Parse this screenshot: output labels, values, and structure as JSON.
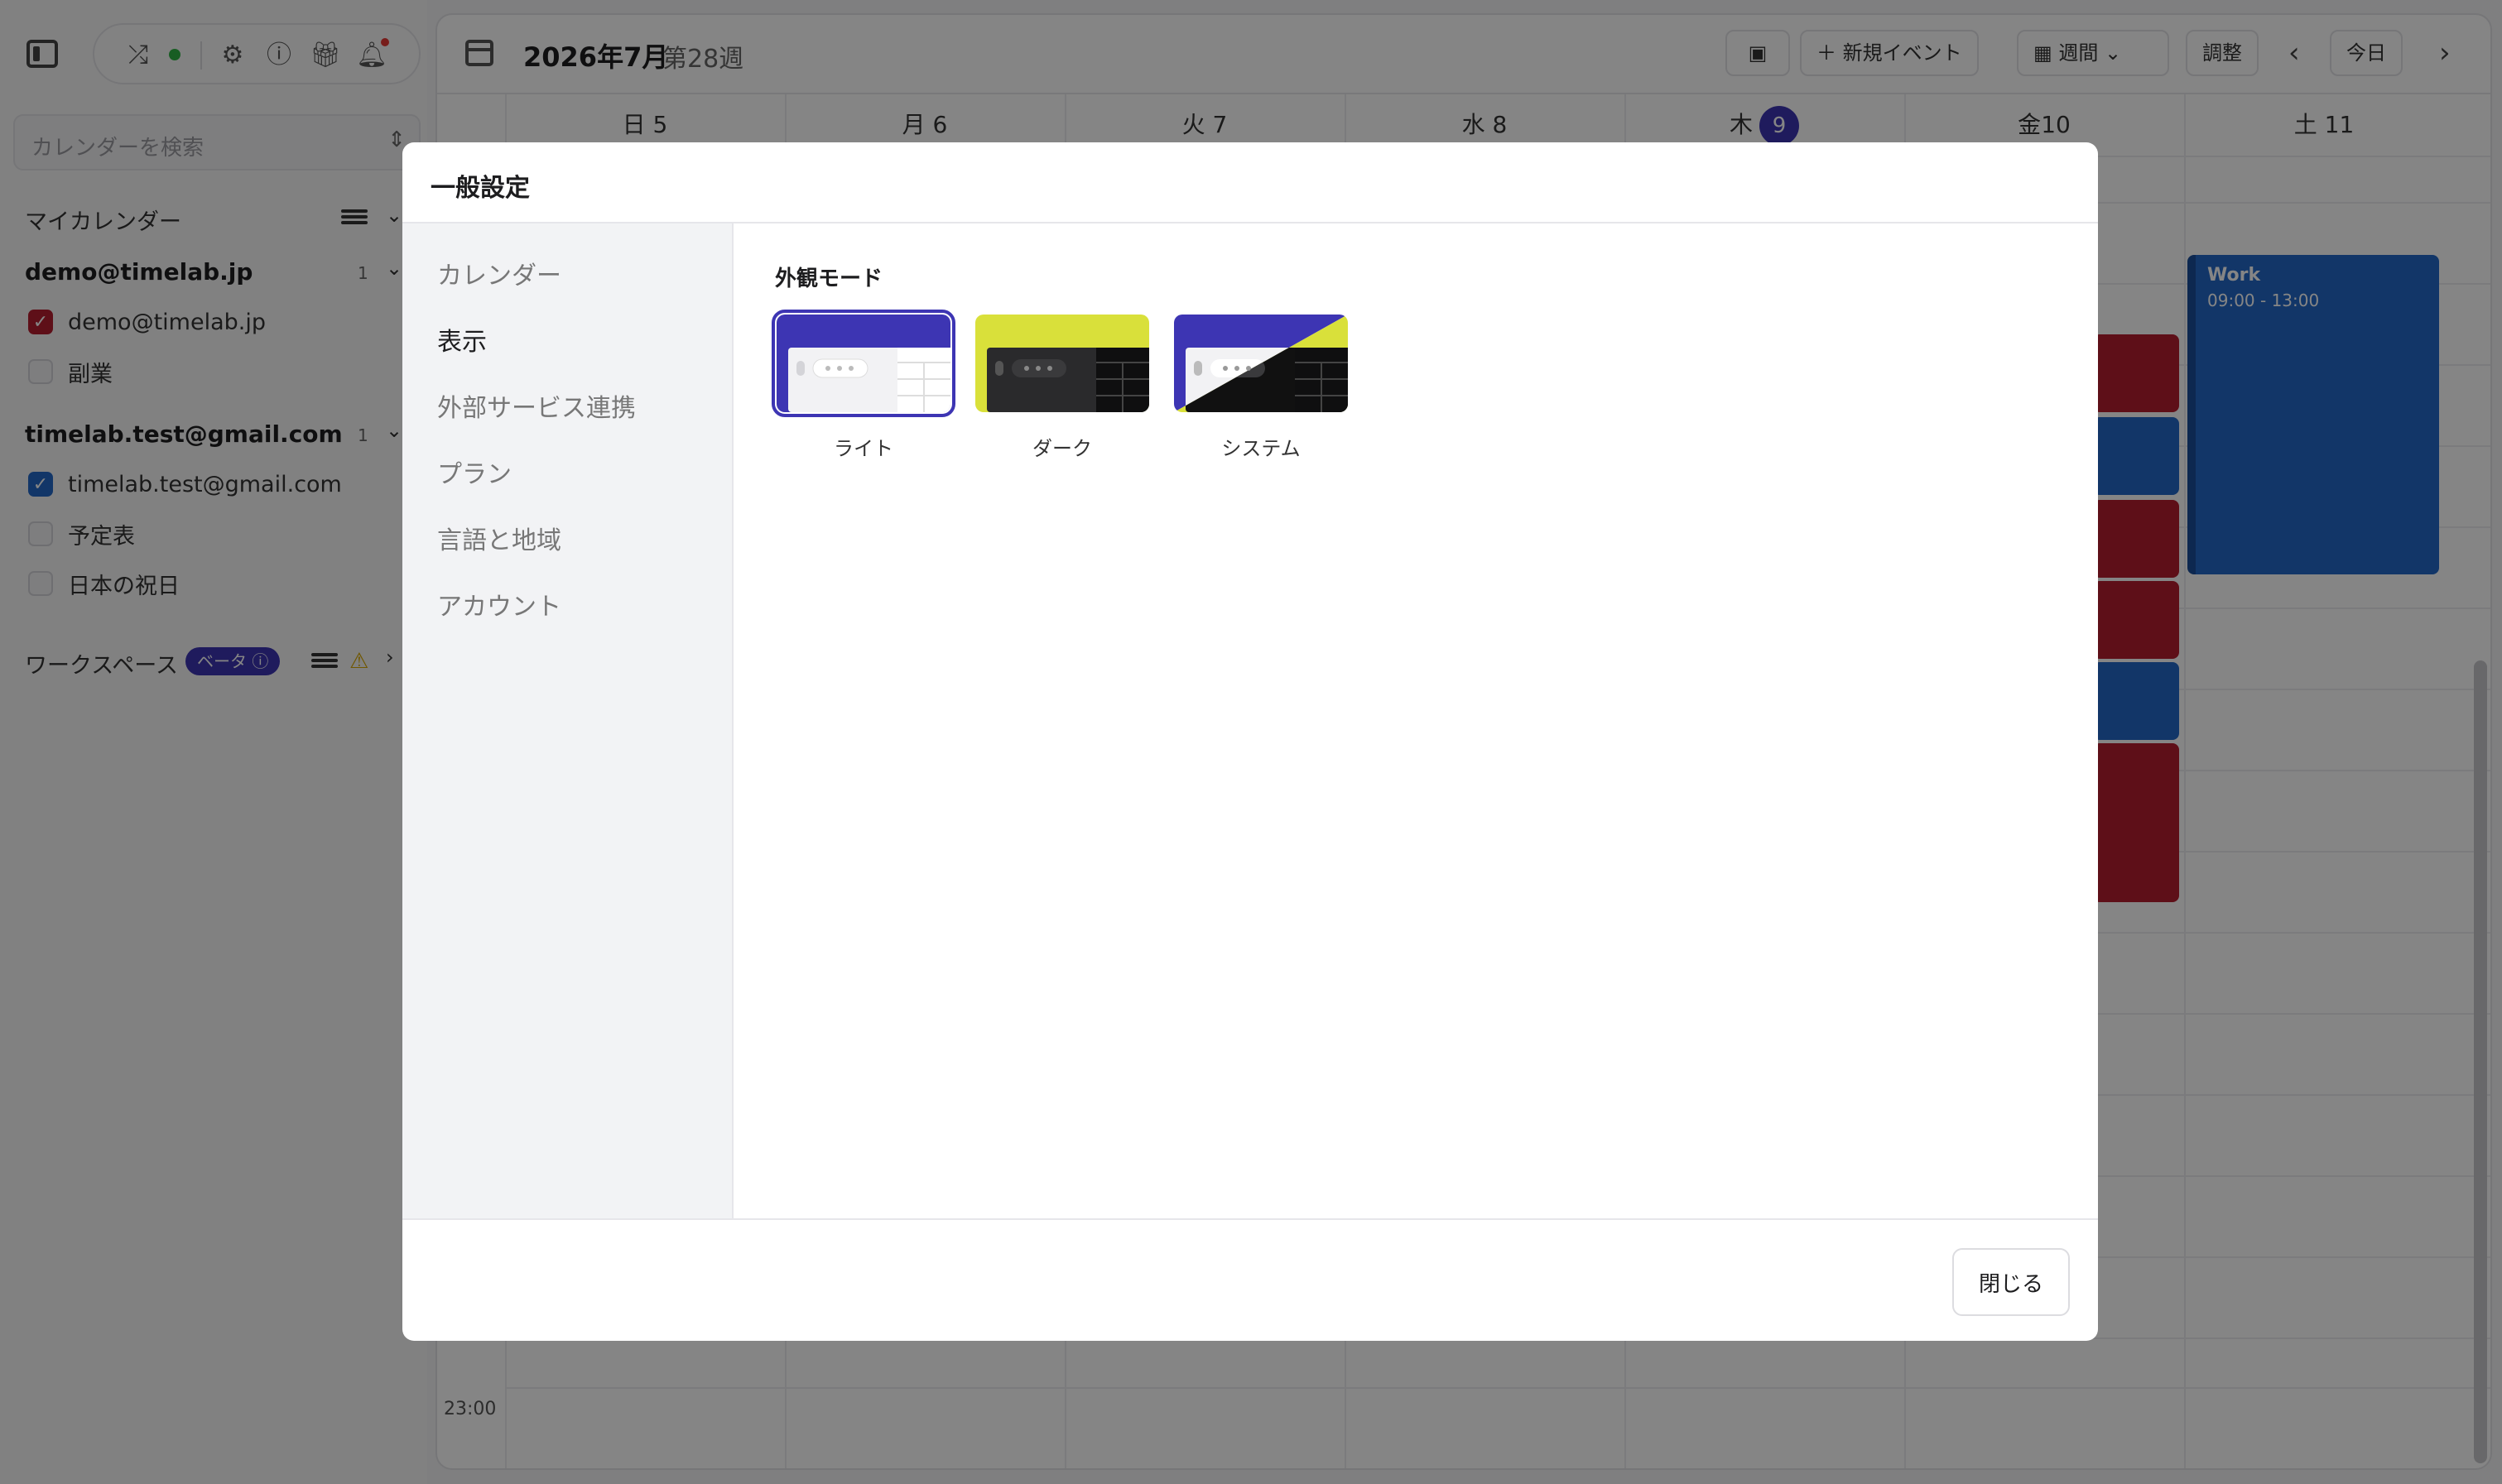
{
  "sidebar": {
    "search_placeholder": "カレンダーを検索",
    "my_calendars_label": "マイカレンダー",
    "accounts": [
      {
        "email": "demo@timelab.jp",
        "count": "1",
        "calendars": [
          {
            "label": "demo@timelab.jp",
            "checked": true,
            "color": "#b51d2e"
          },
          {
            "label": "副業",
            "checked": false
          }
        ]
      },
      {
        "email": "timelab.test@gmail.com",
        "count": "1",
        "calendars": [
          {
            "label": "timelab.test@gmail.com",
            "checked": true,
            "color": "#2369c8"
          },
          {
            "label": "予定表",
            "checked": false
          },
          {
            "label": "日本の祝日",
            "checked": false
          }
        ]
      }
    ],
    "workspace_label": "ワークスペース",
    "beta_label": "ベータ"
  },
  "header": {
    "title": "2026年7月",
    "week": "第28週",
    "new_event_label": "新規イベント",
    "view_label": "週間",
    "adjust_label": "調整",
    "today_label": "今日"
  },
  "calendar": {
    "days": [
      {
        "dow": "日",
        "date": "5"
      },
      {
        "dow": "月",
        "date": "6"
      },
      {
        "dow": "火",
        "date": "7"
      },
      {
        "dow": "水",
        "date": "8"
      },
      {
        "dow": "木",
        "date": "9",
        "today": true
      },
      {
        "dow": "金",
        "date": "10"
      },
      {
        "dow": "土",
        "date": "11"
      }
    ],
    "time_label_last": "23:00",
    "work_event": {
      "title": "Work",
      "time": "09:00 - 13:00"
    }
  },
  "modal": {
    "title": "一般設定",
    "nav": [
      "カレンダー",
      "表示",
      "外部サービス連携",
      "プラン",
      "言語と地域",
      "アカウント"
    ],
    "active_nav": "表示",
    "section_title": "外観モード",
    "themes": [
      {
        "label": "ライト",
        "selected": true
      },
      {
        "label": "ダーク",
        "selected": false
      },
      {
        "label": "システム",
        "selected": false
      }
    ],
    "close_label": "閉じる"
  },
  "colors": {
    "accent": "#3d35b3",
    "event_red": "#b51d2e",
    "event_blue": "#2369c8",
    "dark_theme_bg": "#d9e03a"
  }
}
